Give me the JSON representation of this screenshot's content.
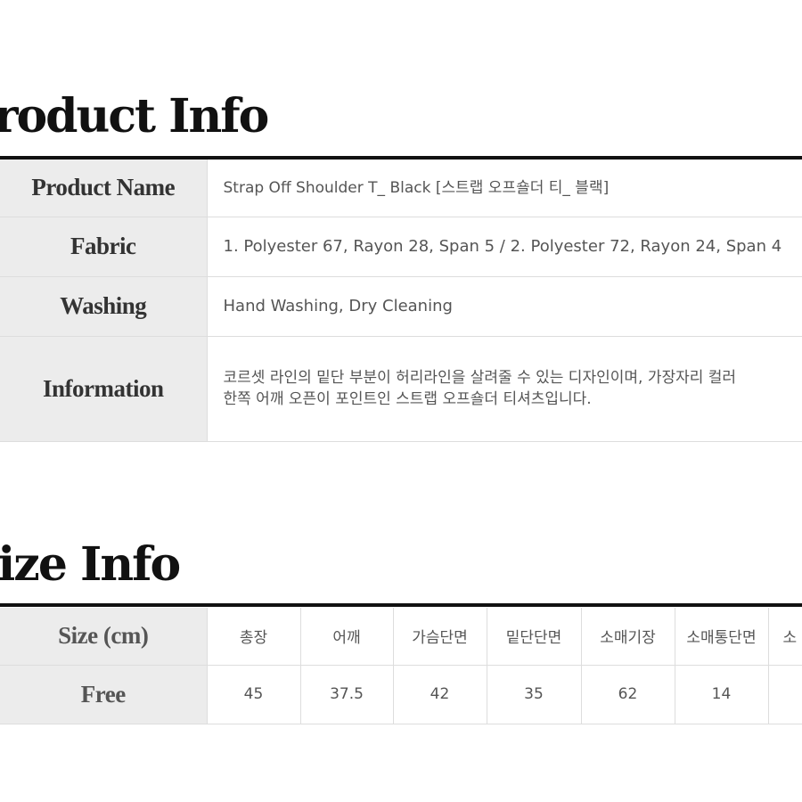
{
  "product_info": {
    "title": "Product Info",
    "rows": [
      {
        "label": "Product Name",
        "value": "Strap Off Shoulder T_ Black [스트랩 오프숄더 티_ 블랙]"
      },
      {
        "label": "Fabric",
        "value": "1. Polyester 67, Rayon 28, Span 5  /  2. Polyester 72, Rayon 24, Span 4"
      },
      {
        "label": "Washing",
        "value": "Hand Washing, Dry Cleaning"
      },
      {
        "label": "Information",
        "lines": [
          "코르셋 라인의 밑단 부분이 허리라인을 살려줄 수 있는 디자인이며, 가장자리 컬러",
          "한쪽 어깨 오픈이 포인트인 스트랩 오프숄더 티셔츠입니다."
        ]
      }
    ]
  },
  "size_info": {
    "title": "Size Info",
    "header_label": "Size (cm)",
    "columns": [
      "총장",
      "어깨",
      "가슴단면",
      "밑단단면",
      "소매기장",
      "소매통단면",
      "소"
    ],
    "row_label": "Free",
    "values": [
      "45",
      "37.5",
      "42",
      "35",
      "62",
      "14",
      ""
    ]
  }
}
